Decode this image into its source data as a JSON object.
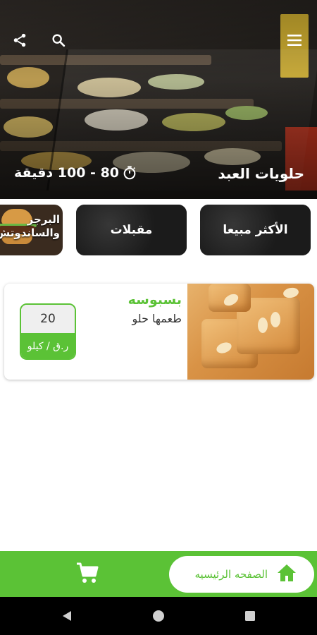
{
  "header": {
    "store_name": "حلويات العبد",
    "delivery_time": "80 - 100 دقيقة",
    "icons": [
      "share-icon",
      "search-icon",
      "menu-icon",
      "timer-icon"
    ]
  },
  "categories": [
    {
      "label": "الأكثر مبيعا"
    },
    {
      "label": "مقبلات"
    },
    {
      "label": "البرجر والساندوتش"
    }
  ],
  "product": {
    "name": "بسبوسه",
    "description": "طعمها حلو",
    "price": "20",
    "unit": "ر.ق / كيلو"
  },
  "bottom_nav": {
    "home_label": "الصفحه الرئيسيه",
    "icons": [
      "home-icon",
      "cart-icon"
    ]
  },
  "colors": {
    "accent": "#5bc236",
    "category_bg": "#1a1a1a",
    "system_nav": "#000000"
  }
}
